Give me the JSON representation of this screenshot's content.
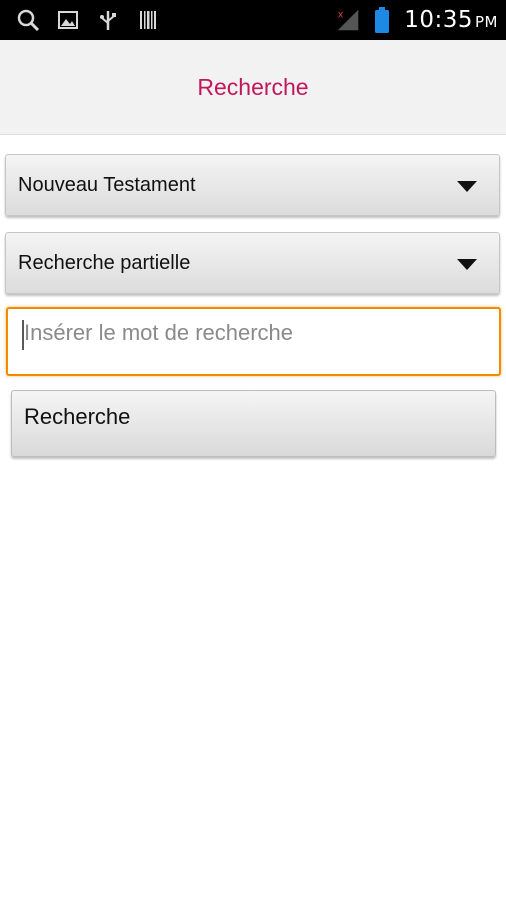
{
  "status_bar": {
    "time": "10:35",
    "ampm": "PM",
    "left_icons": [
      "search-icon",
      "image-icon",
      "usb-icon",
      "barcode-icon"
    ],
    "right_icons": [
      "signal-icon",
      "battery-icon"
    ],
    "battery_color": "#1e88e5",
    "no_signal_color": "#e53935"
  },
  "header": {
    "title": "Recherche",
    "title_color": "#c2185b"
  },
  "form": {
    "testament_select": {
      "selected": "Nouveau Testament"
    },
    "mode_select": {
      "selected": "Recherche partielle"
    },
    "search_input": {
      "value": "",
      "placeholder": "Insérer le mot de recherche",
      "focus_color": "#f08c00"
    },
    "search_button_label": "Recherche"
  }
}
